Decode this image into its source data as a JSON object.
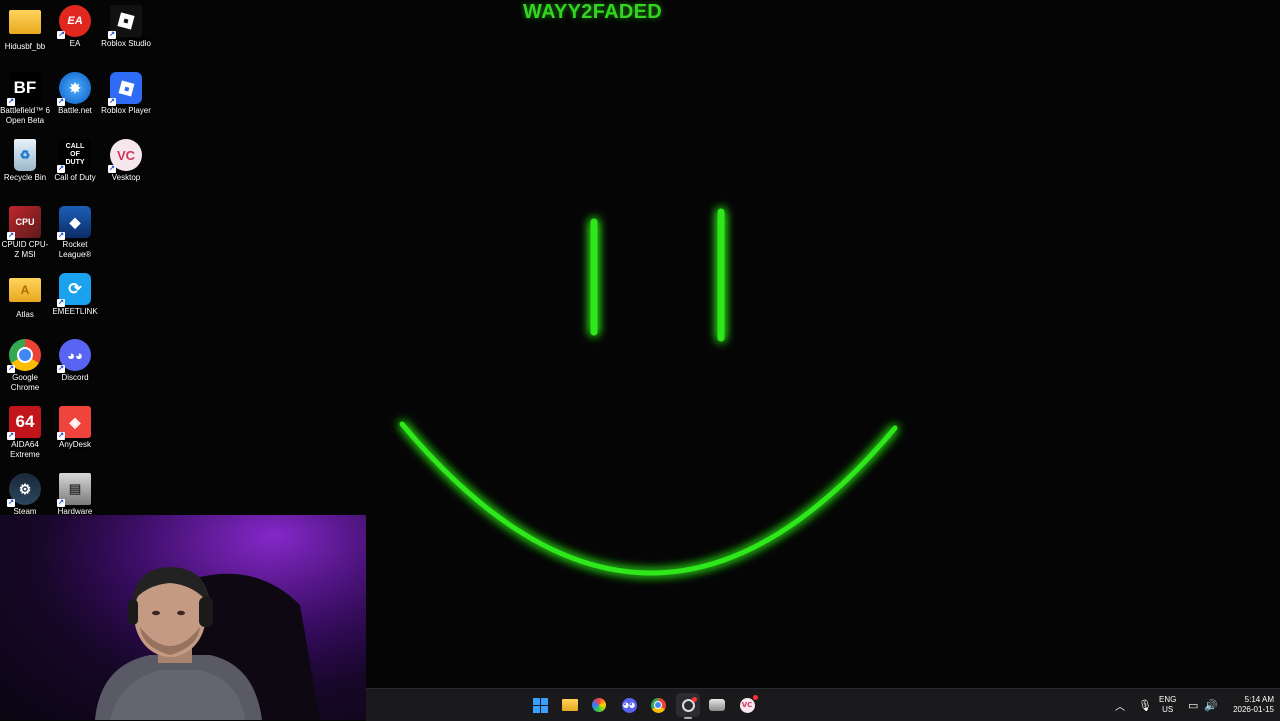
{
  "wallpaper": {
    "title": "WAYY2FADED",
    "accent": "#2ee81a"
  },
  "desktop_icons": [
    {
      "label": "Hidusbf_bb",
      "icon": "folder-icon"
    },
    {
      "label": "EA",
      "icon": "ea-icon"
    },
    {
      "label": "Roblox Studio",
      "icon": "roblox-studio-icon"
    },
    {
      "label": "Battlefield™ 6 Open Beta",
      "icon": "battlefield-icon"
    },
    {
      "label": "Battle.net",
      "icon": "battlenet-icon"
    },
    {
      "label": "Roblox Player",
      "icon": "roblox-player-icon"
    },
    {
      "label": "Recycle Bin",
      "icon": "recycle-bin-icon"
    },
    {
      "label": "Call of Duty",
      "icon": "call-of-duty-icon"
    },
    {
      "label": "Vesktop",
      "icon": "vesktop-icon"
    },
    {
      "label": "CPUID CPU-Z MSI",
      "icon": "cpuz-icon"
    },
    {
      "label": "Rocket League®",
      "icon": "rocket-league-icon"
    },
    {
      "label": "Atlas",
      "icon": "atlas-folder-icon"
    },
    {
      "label": "EMEETLINK",
      "icon": "emeetlink-icon"
    },
    {
      "label": "Google Chrome",
      "icon": "chrome-icon"
    },
    {
      "label": "Discord",
      "icon": "discord-icon"
    },
    {
      "label": "AIDA64 Extreme",
      "icon": "aida64-icon"
    },
    {
      "label": "AnyDesk",
      "icon": "anydesk-icon"
    },
    {
      "label": "Steam",
      "icon": "steam-icon"
    },
    {
      "label": "Hardware",
      "icon": "hardware-icon"
    }
  ],
  "taskbar": {
    "apps": [
      {
        "name": "start",
        "icon": "windows-start-icon"
      },
      {
        "name": "file-explorer",
        "icon": "file-explorer-icon"
      },
      {
        "name": "app-color",
        "icon": "color-app-icon"
      },
      {
        "name": "discord",
        "icon": "discord-icon"
      },
      {
        "name": "chrome",
        "icon": "chrome-icon"
      },
      {
        "name": "capture",
        "icon": "capture-app-icon"
      },
      {
        "name": "app-game",
        "icon": "game-app-icon"
      },
      {
        "name": "vesktop",
        "icon": "vesktop-icon"
      }
    ],
    "tray": {
      "lang_top": "ENG",
      "lang_bottom": "US",
      "time": "5:14 AM",
      "date": "2026-01-15"
    }
  }
}
